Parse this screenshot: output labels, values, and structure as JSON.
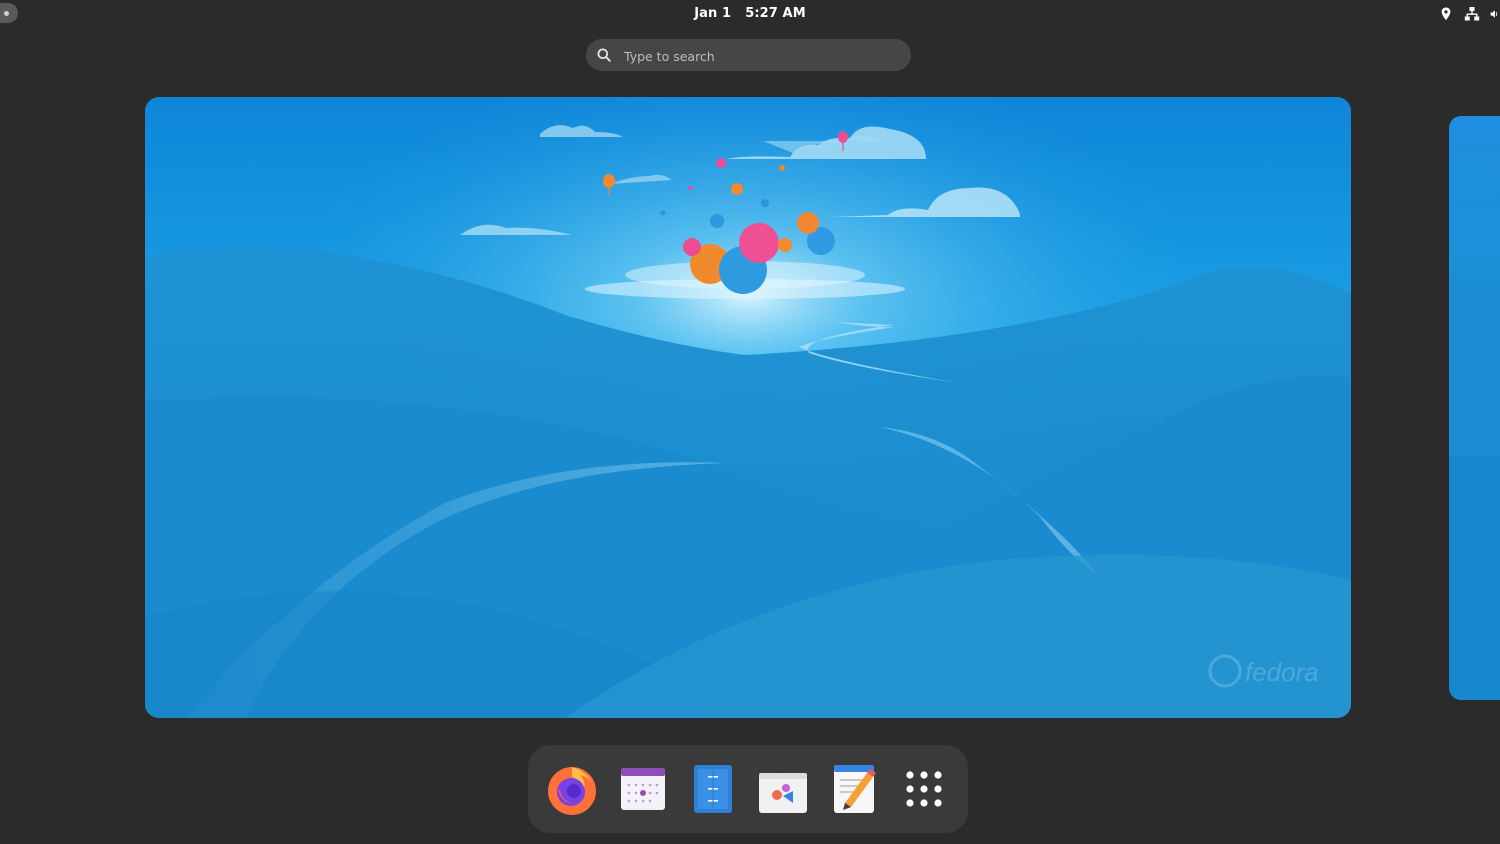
{
  "topbar": {
    "date": "Jan 1",
    "time": "5:27 AM",
    "tray_icons": [
      "location-icon",
      "network-icon",
      "volume-icon"
    ]
  },
  "search": {
    "placeholder": "Type to search",
    "value": ""
  },
  "workspace": {
    "wallpaper_watermark": "fedora"
  },
  "dash": {
    "apps": [
      {
        "icon": "firefox-icon"
      },
      {
        "icon": "calendar-icon"
      },
      {
        "icon": "files-icon"
      },
      {
        "icon": "software-store-icon"
      },
      {
        "icon": "text-editor-icon"
      },
      {
        "icon": "show-apps-grid-icon"
      }
    ]
  },
  "colors": {
    "panel_bg": "#2b2b2b",
    "search_bg": "#464646",
    "dash_bg": "#3a3a3a",
    "wallpaper_sky": "#1a8ad6"
  }
}
